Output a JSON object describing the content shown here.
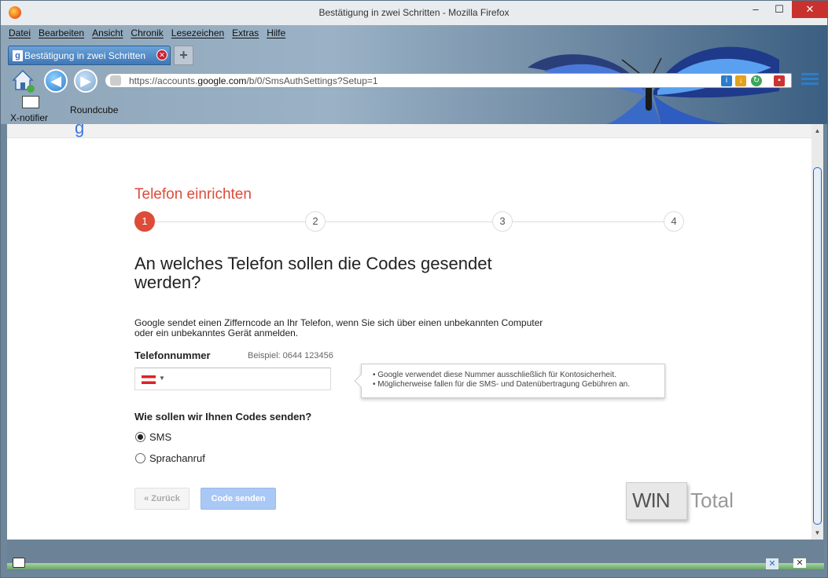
{
  "window": {
    "title": "Bestätigung in zwei Schritten - Mozilla Firefox",
    "min": "–",
    "max": "☐",
    "close": "✕"
  },
  "menu": [
    "Datei",
    "Bearbeiten",
    "Ansicht",
    "Chronik",
    "Lesezeichen",
    "Extras",
    "Hilfe"
  ],
  "tab": {
    "favicon": "g",
    "label": "Bestätigung in zwei Schritten",
    "newtab": "+"
  },
  "url": {
    "prefix": "https://accounts.",
    "domain": "google.com",
    "path": "/b/0/SmsAuthSettings?Setup=1"
  },
  "bookmarks": {
    "xnotifier": "X-notifier",
    "roundcube": "Roundcube"
  },
  "page": {
    "heading": "Telefon einrichten",
    "steps": [
      "1",
      "2",
      "3",
      "4"
    ],
    "active_step": 1,
    "question": "An welches Telefon sollen die Codes gesendet werden?",
    "description": "Google sendet einen Zifferncode an Ihr Telefon, wenn Sie sich über einen unbekannten Computer oder ein unbekanntes Gerät anmelden.",
    "phone_label": "Telefonnummer",
    "phone_example": "Beispiel: 0644 123456",
    "phone_value": "",
    "tooltip": [
      "Google verwendet diese Nummer ausschließlich für Kontosicherheit.",
      "Möglicherweise fallen für die SMS- und Datenübertragung Gebühren an."
    ],
    "method_question": "Wie sollen wir Ihnen Codes senden?",
    "options": [
      {
        "label": "SMS",
        "selected": true
      },
      {
        "label": "Sprachanruf",
        "selected": false
      }
    ],
    "back_button": "« Zurück",
    "send_button": "Code senden"
  },
  "watermark": {
    "part1": "WIN",
    "part2": "Total"
  },
  "colors": {
    "accent_red": "#dd4b39",
    "send_button": "#a9c8f5",
    "link_blue": "#3d77d9"
  }
}
